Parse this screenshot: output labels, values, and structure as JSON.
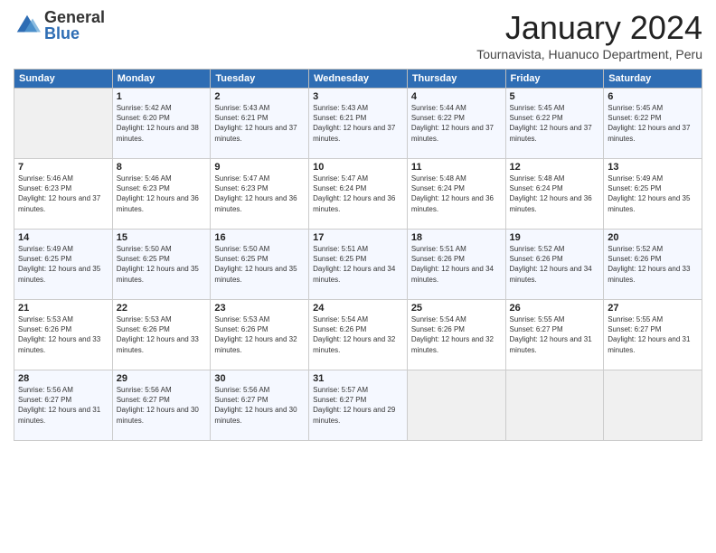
{
  "logo": {
    "general": "General",
    "blue": "Blue"
  },
  "title": "January 2024",
  "subtitle": "Tournavista, Huanuco Department, Peru",
  "days_of_week": [
    "Sunday",
    "Monday",
    "Tuesday",
    "Wednesday",
    "Thursday",
    "Friday",
    "Saturday"
  ],
  "weeks": [
    [
      {
        "day": "",
        "empty": true
      },
      {
        "day": "1",
        "sunrise": "5:42 AM",
        "sunset": "6:20 PM",
        "daylight": "12 hours and 38 minutes."
      },
      {
        "day": "2",
        "sunrise": "5:43 AM",
        "sunset": "6:21 PM",
        "daylight": "12 hours and 37 minutes."
      },
      {
        "day": "3",
        "sunrise": "5:43 AM",
        "sunset": "6:21 PM",
        "daylight": "12 hours and 37 minutes."
      },
      {
        "day": "4",
        "sunrise": "5:44 AM",
        "sunset": "6:22 PM",
        "daylight": "12 hours and 37 minutes."
      },
      {
        "day": "5",
        "sunrise": "5:45 AM",
        "sunset": "6:22 PM",
        "daylight": "12 hours and 37 minutes."
      },
      {
        "day": "6",
        "sunrise": "5:45 AM",
        "sunset": "6:22 PM",
        "daylight": "12 hours and 37 minutes."
      }
    ],
    [
      {
        "day": "7",
        "sunrise": "5:46 AM",
        "sunset": "6:23 PM",
        "daylight": "12 hours and 37 minutes."
      },
      {
        "day": "8",
        "sunrise": "5:46 AM",
        "sunset": "6:23 PM",
        "daylight": "12 hours and 36 minutes."
      },
      {
        "day": "9",
        "sunrise": "5:47 AM",
        "sunset": "6:23 PM",
        "daylight": "12 hours and 36 minutes."
      },
      {
        "day": "10",
        "sunrise": "5:47 AM",
        "sunset": "6:24 PM",
        "daylight": "12 hours and 36 minutes."
      },
      {
        "day": "11",
        "sunrise": "5:48 AM",
        "sunset": "6:24 PM",
        "daylight": "12 hours and 36 minutes."
      },
      {
        "day": "12",
        "sunrise": "5:48 AM",
        "sunset": "6:24 PM",
        "daylight": "12 hours and 36 minutes."
      },
      {
        "day": "13",
        "sunrise": "5:49 AM",
        "sunset": "6:25 PM",
        "daylight": "12 hours and 35 minutes."
      }
    ],
    [
      {
        "day": "14",
        "sunrise": "5:49 AM",
        "sunset": "6:25 PM",
        "daylight": "12 hours and 35 minutes."
      },
      {
        "day": "15",
        "sunrise": "5:50 AM",
        "sunset": "6:25 PM",
        "daylight": "12 hours and 35 minutes."
      },
      {
        "day": "16",
        "sunrise": "5:50 AM",
        "sunset": "6:25 PM",
        "daylight": "12 hours and 35 minutes."
      },
      {
        "day": "17",
        "sunrise": "5:51 AM",
        "sunset": "6:25 PM",
        "daylight": "12 hours and 34 minutes."
      },
      {
        "day": "18",
        "sunrise": "5:51 AM",
        "sunset": "6:26 PM",
        "daylight": "12 hours and 34 minutes."
      },
      {
        "day": "19",
        "sunrise": "5:52 AM",
        "sunset": "6:26 PM",
        "daylight": "12 hours and 34 minutes."
      },
      {
        "day": "20",
        "sunrise": "5:52 AM",
        "sunset": "6:26 PM",
        "daylight": "12 hours and 33 minutes."
      }
    ],
    [
      {
        "day": "21",
        "sunrise": "5:53 AM",
        "sunset": "6:26 PM",
        "daylight": "12 hours and 33 minutes."
      },
      {
        "day": "22",
        "sunrise": "5:53 AM",
        "sunset": "6:26 PM",
        "daylight": "12 hours and 33 minutes."
      },
      {
        "day": "23",
        "sunrise": "5:53 AM",
        "sunset": "6:26 PM",
        "daylight": "12 hours and 32 minutes."
      },
      {
        "day": "24",
        "sunrise": "5:54 AM",
        "sunset": "6:26 PM",
        "daylight": "12 hours and 32 minutes."
      },
      {
        "day": "25",
        "sunrise": "5:54 AM",
        "sunset": "6:26 PM",
        "daylight": "12 hours and 32 minutes."
      },
      {
        "day": "26",
        "sunrise": "5:55 AM",
        "sunset": "6:27 PM",
        "daylight": "12 hours and 31 minutes."
      },
      {
        "day": "27",
        "sunrise": "5:55 AM",
        "sunset": "6:27 PM",
        "daylight": "12 hours and 31 minutes."
      }
    ],
    [
      {
        "day": "28",
        "sunrise": "5:56 AM",
        "sunset": "6:27 PM",
        "daylight": "12 hours and 31 minutes."
      },
      {
        "day": "29",
        "sunrise": "5:56 AM",
        "sunset": "6:27 PM",
        "daylight": "12 hours and 30 minutes."
      },
      {
        "day": "30",
        "sunrise": "5:56 AM",
        "sunset": "6:27 PM",
        "daylight": "12 hours and 30 minutes."
      },
      {
        "day": "31",
        "sunrise": "5:57 AM",
        "sunset": "6:27 PM",
        "daylight": "12 hours and 29 minutes."
      },
      {
        "day": "",
        "empty": true
      },
      {
        "day": "",
        "empty": true
      },
      {
        "day": "",
        "empty": true
      }
    ]
  ]
}
